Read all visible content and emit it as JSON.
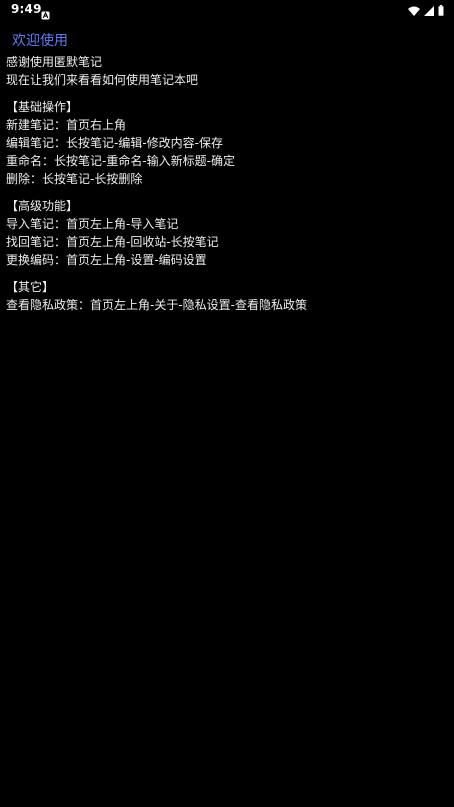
{
  "status_bar": {
    "time": "9:49",
    "icons": [
      "notification-a-icon",
      "wifi-icon",
      "signal-icon",
      "battery-icon"
    ]
  },
  "page": {
    "title": "欢迎使用",
    "intro": [
      "感谢使用匿默笔记",
      "现在让我们来看看如何使用笔记本吧"
    ],
    "sections": [
      {
        "heading": "【基础操作】",
        "lines": [
          "新建笔记：首页右上角",
          "编辑笔记：长按笔记-编辑-修改内容-保存",
          "重命名：长按笔记-重命名-输入新标题-确定",
          "删除：长按笔记-长按删除"
        ]
      },
      {
        "heading": "【高级功能】",
        "lines": [
          "导入笔记：首页左上角-导入笔记",
          "找回笔记：首页左上角-回收站-长按笔记",
          "更换编码：首页左上角-设置-编码设置"
        ]
      },
      {
        "heading": "【其它】",
        "lines": [
          "查看隐私政策：首页左上角-关于-隐私设置-查看隐私政策"
        ]
      }
    ]
  },
  "colors": {
    "background": "#000000",
    "title": "#5b7cf2",
    "text": "#eeeeee"
  }
}
